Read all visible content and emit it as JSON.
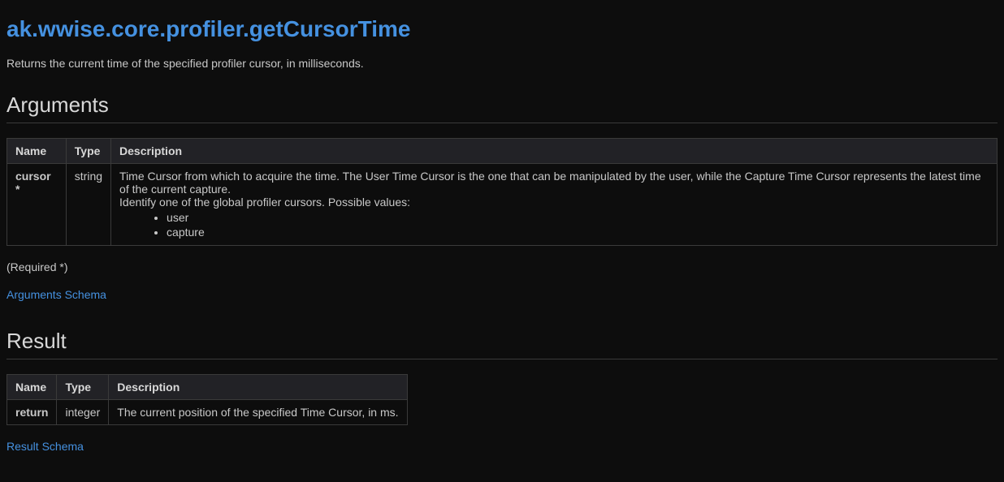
{
  "title": "ak.wwise.core.profiler.getCursorTime",
  "description": "Returns the current time of the specified profiler cursor, in milliseconds.",
  "arguments": {
    "heading": "Arguments",
    "columns": {
      "name": "Name",
      "type": "Type",
      "description": "Description"
    },
    "row": {
      "name": "cursor *",
      "type": "string",
      "desc_line1": "Time Cursor from which to acquire the time. The User Time Cursor is the one that can be manipulated by the user, while the Capture Time Cursor represents the latest time of the current capture.",
      "desc_line2": "Identify one of the global profiler cursors. Possible values:",
      "values": {
        "v1": "user",
        "v2": "capture"
      }
    },
    "required_note": "(Required *)",
    "schema_link": "Arguments Schema"
  },
  "result": {
    "heading": "Result",
    "columns": {
      "name": "Name",
      "type": "Type",
      "description": "Description"
    },
    "row": {
      "name": "return",
      "type": "integer",
      "description": "The current position of the specified Time Cursor, in ms."
    },
    "schema_link": "Result Schema"
  }
}
